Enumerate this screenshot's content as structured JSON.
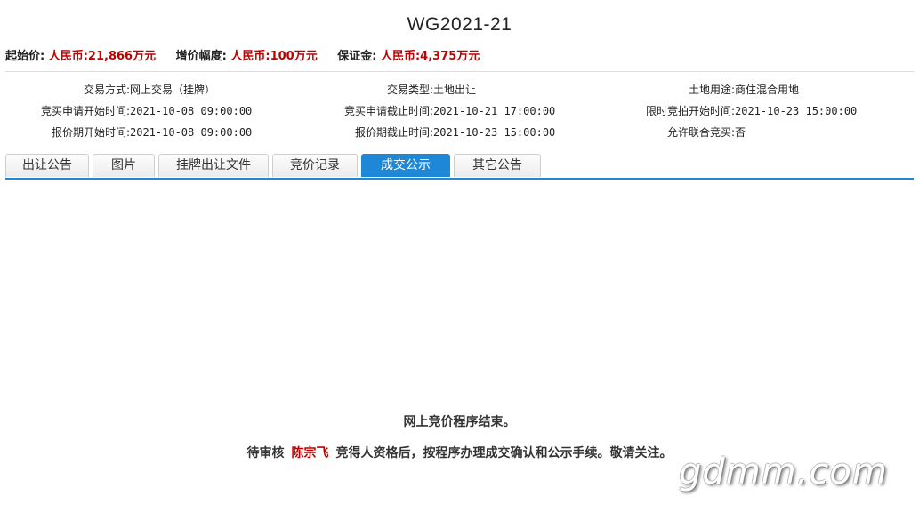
{
  "title": "WG2021-21",
  "price": {
    "start_label": "起始价:",
    "start_value": "人民币:21,866万元",
    "increment_label": "增价幅度:",
    "increment_value": "人民币:100万元",
    "deposit_label": "保证金:",
    "deposit_value": "人民币:4,375万元"
  },
  "info": {
    "row1": [
      {
        "label": "交易方式:",
        "value": "网上交易（挂牌）"
      },
      {
        "label": "交易类型:",
        "value": "土地出让"
      },
      {
        "label": "土地用途:",
        "value": "商住混合用地"
      }
    ],
    "row2": [
      {
        "label": "竞买申请开始时间:",
        "value": "2021-10-08 09:00:00"
      },
      {
        "label": "竞买申请截止时间:",
        "value": "2021-10-21 17:00:00"
      },
      {
        "label": "限时竞拍开始时间:",
        "value": "2021-10-23 15:00:00"
      }
    ],
    "row3": [
      {
        "label": "报价期开始时间:",
        "value": "2021-10-08 09:00:00"
      },
      {
        "label": "报价期截止时间:",
        "value": "2021-10-23 15:00:00"
      },
      {
        "label": "允许联合竞买:",
        "value": "否"
      }
    ]
  },
  "tabs": [
    {
      "label": "出让公告",
      "active": false
    },
    {
      "label": "图片",
      "active": false
    },
    {
      "label": "挂牌出让文件",
      "active": false
    },
    {
      "label": "竞价记录",
      "active": false
    },
    {
      "label": "成交公示",
      "active": true
    },
    {
      "label": "其它公告",
      "active": false
    }
  ],
  "content": {
    "line1": "网上竞价程序结束。",
    "line2_prefix": "待审核",
    "line2_name": "陈宗飞",
    "line2_suffix": "竞得人资格后，按程序办理成交确认和公示手续。敬请关注。"
  },
  "watermark": "gdmm.com",
  "colors": {
    "accent": "#1e87d6",
    "highlight": "#c00000"
  }
}
